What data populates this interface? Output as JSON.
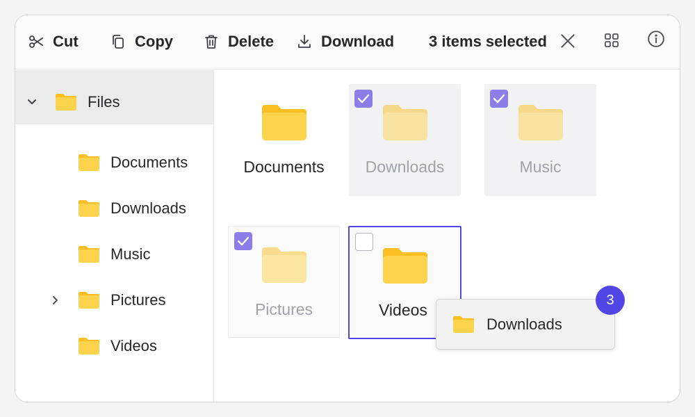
{
  "toolbar": {
    "cut_label": "Cut",
    "copy_label": "Copy",
    "delete_label": "Delete",
    "download_label": "Download",
    "selection_text": "3 items selected"
  },
  "sidebar": {
    "root_label": "Files",
    "items": [
      {
        "label": "Documents",
        "expandable": false
      },
      {
        "label": "Downloads",
        "expandable": false
      },
      {
        "label": "Music",
        "expandable": false
      },
      {
        "label": "Pictures",
        "expandable": true
      },
      {
        "label": "Videos",
        "expandable": false
      }
    ]
  },
  "grid": {
    "tiles": [
      {
        "label": "Documents",
        "selected": false
      },
      {
        "label": "Downloads",
        "selected": true
      },
      {
        "label": "Music",
        "selected": true
      },
      {
        "label": "Pictures",
        "selected": true
      },
      {
        "label": "Videos",
        "selected": false,
        "focused": true
      }
    ]
  },
  "drag": {
    "label": "Downloads",
    "count": "3"
  },
  "colors": {
    "accent": "#4f46e5",
    "checkbox": "#8b7ee8",
    "folder": "#fcd34d",
    "folder_dark": "#fbbf24"
  },
  "icons": [
    "scissors-icon",
    "copy-icon",
    "trash-icon",
    "download-icon",
    "close-icon",
    "grid-view-icon",
    "info-icon",
    "folder-icon",
    "chevron-down-icon",
    "chevron-right-icon",
    "checkmark-icon"
  ]
}
